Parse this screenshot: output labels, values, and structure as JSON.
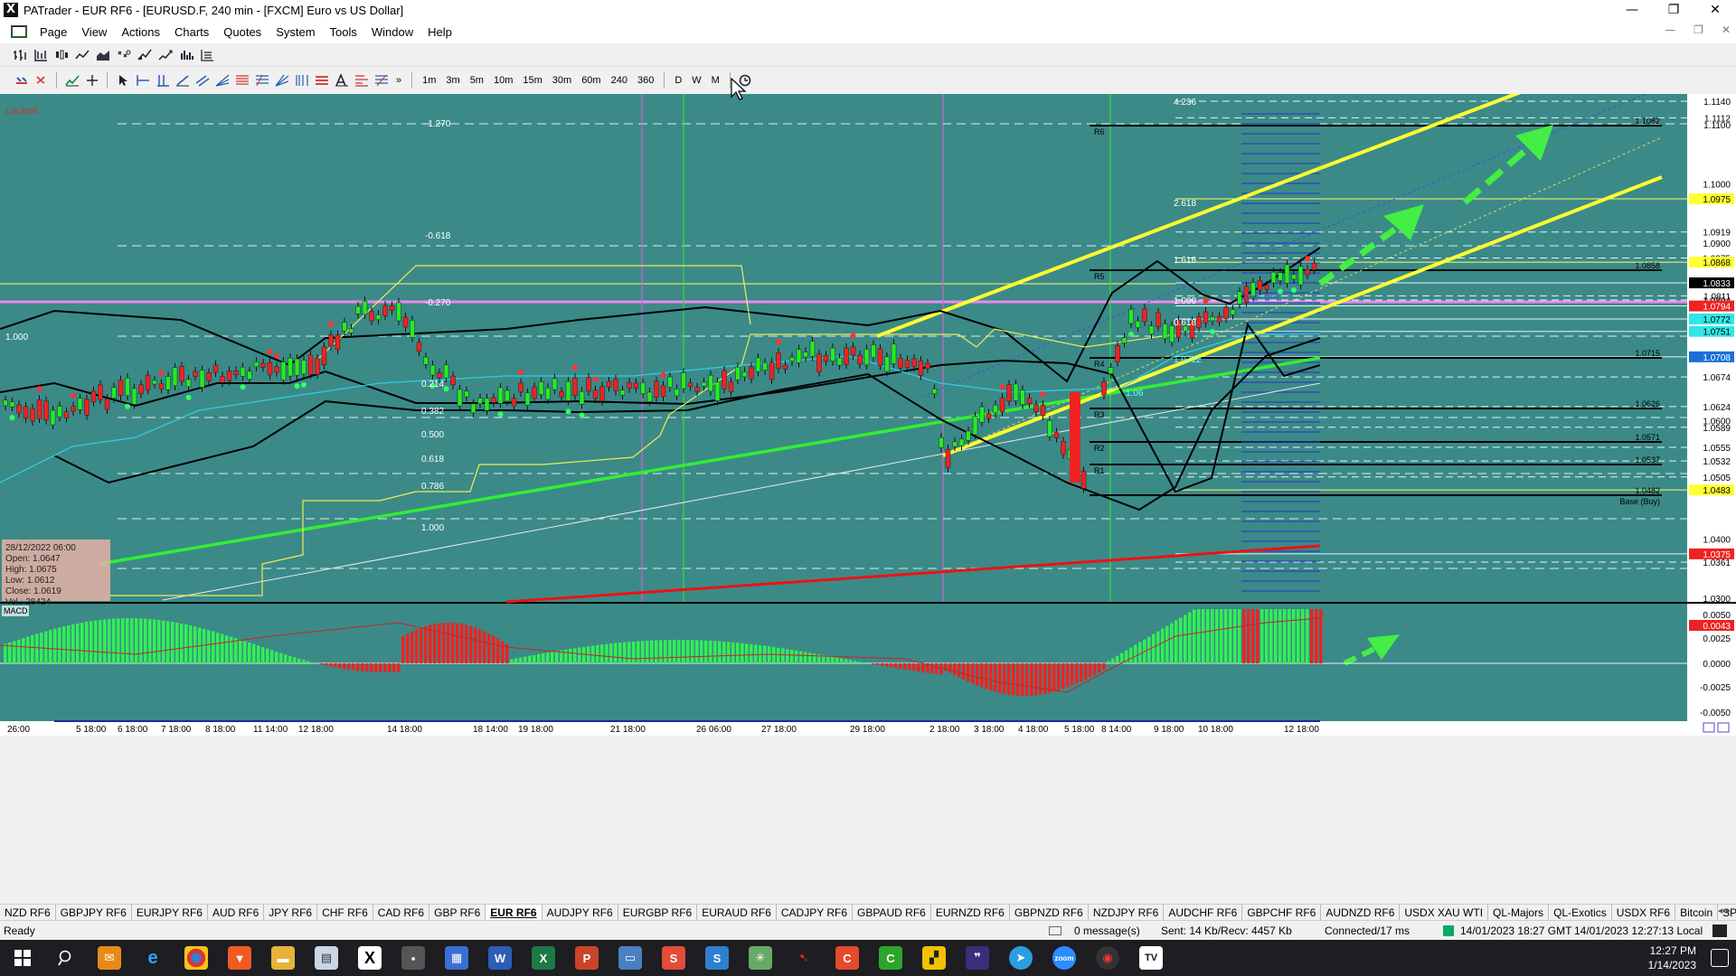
{
  "window": {
    "title": "PATrader - EUR RF6 - [EURUSD.F, 240 min - [FXCM] Euro vs US Dollar]",
    "app_icon": "X",
    "controls": [
      "—",
      "❐",
      "✕"
    ]
  },
  "menu": {
    "items": [
      "Page",
      "View",
      "Actions",
      "Charts",
      "Quotes",
      "System",
      "Tools",
      "Window",
      "Help"
    ],
    "mdi_controls": [
      "—",
      "❐",
      "✕"
    ]
  },
  "toolbar": {
    "timeframes": [
      "1m",
      "3m",
      "5m",
      "10m",
      "15m",
      "30m",
      "60m",
      "240",
      "360"
    ],
    "periods": [
      "D",
      "W",
      "M"
    ]
  },
  "chart": {
    "locked_label": "Locked",
    "background": "#3b8a88",
    "price_labels": [
      {
        "v": "1.1140",
        "cls": "w"
      },
      {
        "v": "1.1112",
        "cls": "w"
      },
      {
        "v": "1.1100",
        "cls": "n"
      },
      {
        "v": "1.1000",
        "cls": "n"
      },
      {
        "v": "1.0975",
        "cls": "y"
      },
      {
        "v": "1.0919",
        "cls": "w"
      },
      {
        "v": "1.0900",
        "cls": "n"
      },
      {
        "v": "1.0875",
        "cls": "w"
      },
      {
        "v": "1.0868",
        "cls": "y"
      },
      {
        "v": "1.0833",
        "cls": "k"
      },
      {
        "v": "1.0811",
        "cls": "w"
      },
      {
        "v": "1.0804",
        "cls": "w"
      },
      {
        "v": "1.0794",
        "cls": "r"
      },
      {
        "v": "1.0772",
        "cls": "c"
      },
      {
        "v": "1.0751",
        "cls": "c"
      },
      {
        "v": "1.0708",
        "cls": "b"
      },
      {
        "v": "1.0674",
        "cls": "w"
      },
      {
        "v": "1.0624",
        "cls": "w"
      },
      {
        "v": "1.0600",
        "cls": "n"
      },
      {
        "v": "1.0589",
        "cls": "w"
      },
      {
        "v": "1.0555",
        "cls": "w"
      },
      {
        "v": "1.0532",
        "cls": "w"
      },
      {
        "v": "1.0505",
        "cls": "w"
      },
      {
        "v": "1.0483",
        "cls": "y"
      },
      {
        "v": "1.0400",
        "cls": "n"
      },
      {
        "v": "1.0375",
        "cls": "r"
      },
      {
        "v": "1.0361",
        "cls": "w"
      },
      {
        "v": "1.0300",
        "cls": "n"
      }
    ],
    "macd_labels": [
      "0.0050",
      "0.0043",
      "0.0025",
      "0.0000",
      "-0.0025",
      "-0.0050"
    ],
    "macd_title": "MACD",
    "fib_left": [
      "-1.270",
      "-0.618",
      "-0.270",
      "1.000",
      "0.214",
      "0.382",
      "0.500",
      "0.618",
      "0.786",
      "1.000"
    ],
    "fib_right": [
      "4.236",
      "2.618",
      "1.618",
      "1.000",
      "0.618",
      "1.0712",
      "1.06"
    ],
    "pivots": [
      {
        "name": "R6",
        "value": "1.1082"
      },
      {
        "name": "R5",
        "value": "1.0858"
      },
      {
        "name": "R4",
        "value": "1.0715"
      },
      {
        "name": "R3",
        "value": "1.0626"
      },
      {
        "name": "R2",
        "value": "1.0571"
      },
      {
        "name": "R1",
        "value": "1.0537"
      },
      {
        "name": "Base (Buy)",
        "value": "1.0482"
      }
    ],
    "cross_label": "Cross Line",
    "ohlc": {
      "date": "28/12/2022 06:00",
      "open": "Open: 1.0647",
      "high": "High: 1.0675",
      "low": "Low: 1.0612",
      "close": "Close: 1.0619",
      "vol": "Vol.: 28424"
    },
    "dates": [
      "26:00",
      "5 18:00",
      "6 18:00",
      "7 18:00",
      "8 18:00",
      "11 14:00",
      "12 18:00",
      "14 18:00",
      "18 14:00",
      "19 18:00",
      "21 18:00",
      "26 06:00",
      "27 18:00",
      "29 18:00",
      "2 18:00",
      "3 18:00",
      "4 18:00",
      "5 18:00",
      "8 14:00",
      "9 18:00",
      "10 18:00",
      "12 18:00"
    ],
    "colors": {
      "bull": "#22ee22",
      "bear": "#ee2222",
      "channel": "#ffff33",
      "trend": "#33ee33",
      "ma_red": "#ee1111"
    }
  },
  "tabs": [
    "NZD RF6",
    "GBPJPY RF6",
    "EURJPY RF6",
    "AUD RF6",
    "JPY RF6",
    "CHF RF6",
    "CAD RF6",
    "GBP RF6",
    "EUR RF6",
    "AUDJPY RF6",
    "EURGBP RF6",
    "EURAUD RF6",
    "CADJPY RF6",
    "GBPAUD RF6",
    "EURNZD RF6",
    "GBPNZD RF6",
    "NZDJPY RF6",
    "AUDCHF RF6",
    "GBPCHF RF6",
    "AUDNZD RF6",
    "USDX XAU WTI",
    "QL-Majors",
    "QL-Exotics",
    "USDX RF6",
    "Bitcoin",
    "SP500"
  ],
  "active_tab": "EUR RF6",
  "status": {
    "ready": "Ready",
    "messages": "0 message(s)",
    "traffic": "Sent: 14 Kb/Recv: 4457 Kb",
    "connection": "Connected/17 ms",
    "gmt": "14/01/2023 18:27 GMT",
    "local": "14/01/2023 12:27:13 Local"
  },
  "taskbar": {
    "time": "12:27 PM",
    "date": "1/14/2023"
  }
}
